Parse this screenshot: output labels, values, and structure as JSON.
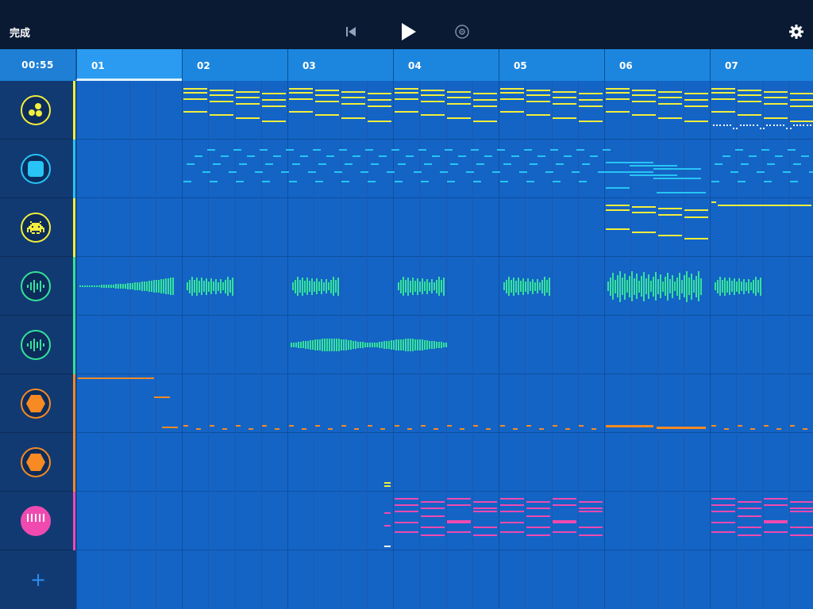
{
  "toolbar": {
    "done_label": "完成",
    "rewind_icon": "skip-back-icon",
    "play_icon": "play-icon",
    "record_icon": "record-icon",
    "settings_icon": "gear-icon"
  },
  "timeline": {
    "time": "00:55",
    "bars": [
      "01",
      "02",
      "03",
      "04",
      "05",
      "06",
      "07"
    ],
    "active_bar": "01"
  },
  "tracks": [
    {
      "id": "drums",
      "icon": "dots-icon",
      "color": "#f2ee3c"
    },
    {
      "id": "synth",
      "icon": "square-icon",
      "color": "#27c4f5"
    },
    {
      "id": "arcade",
      "icon": "invader-icon",
      "color": "#f2ee3c"
    },
    {
      "id": "audio-1",
      "icon": "waveform-icon",
      "color": "#35e29a"
    },
    {
      "id": "audio-2",
      "icon": "waveform-icon",
      "color": "#35e29a"
    },
    {
      "id": "bass",
      "icon": "hexagon-icon",
      "color": "#f78a22"
    },
    {
      "id": "bass-2",
      "icon": "hexagon-icon",
      "color": "#f78a22"
    },
    {
      "id": "keys",
      "icon": "piano-icon",
      "color": "#f04ab0"
    }
  ],
  "add_track_label": "+"
}
